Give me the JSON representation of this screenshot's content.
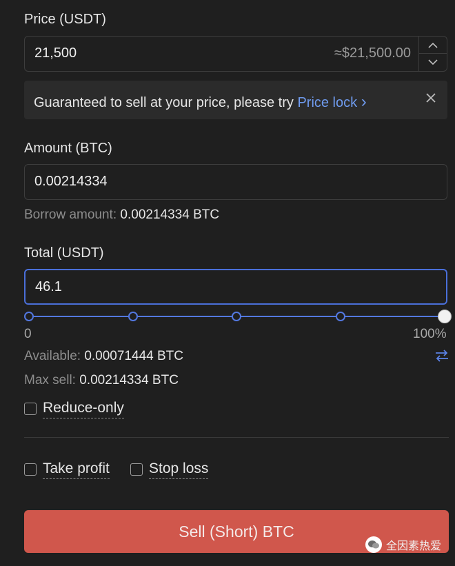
{
  "price": {
    "label": "Price (USDT)",
    "value": "21,500",
    "usd_equivalent": "≈$21,500.00"
  },
  "price_lock_banner": {
    "text": "Guaranteed to sell at your price, please try",
    "link_label": "Price lock",
    "link_arrow": "›",
    "close_icon": "close-icon"
  },
  "amount": {
    "label": "Amount (BTC)",
    "value": "0.00214334",
    "borrow_label": "Borrow amount:",
    "borrow_value": "0.00214334 BTC"
  },
  "total": {
    "label": "Total (USDT)",
    "value": "46.1"
  },
  "slider": {
    "min_label": "0",
    "max_label": "100%",
    "level": 1.0
  },
  "available": {
    "label": "Available:",
    "value": "0.00071444 BTC",
    "icon": "transfer-icon"
  },
  "max_sell": {
    "label": "Max sell:",
    "value": "0.00214334 BTC"
  },
  "reduce_only": {
    "label": "Reduce-only",
    "checked": false
  },
  "take_profit": {
    "label": "Take profit",
    "checked": false
  },
  "stop_loss": {
    "label": "Stop loss",
    "checked": false
  },
  "sell_button": {
    "label": "Sell (Short) BTC"
  },
  "watermark": {
    "text": "全因素热爱"
  },
  "colors": {
    "background": "#1f1f1f",
    "accent": "#5378e0",
    "link": "#6f9bef",
    "sell": "#d0574c"
  }
}
